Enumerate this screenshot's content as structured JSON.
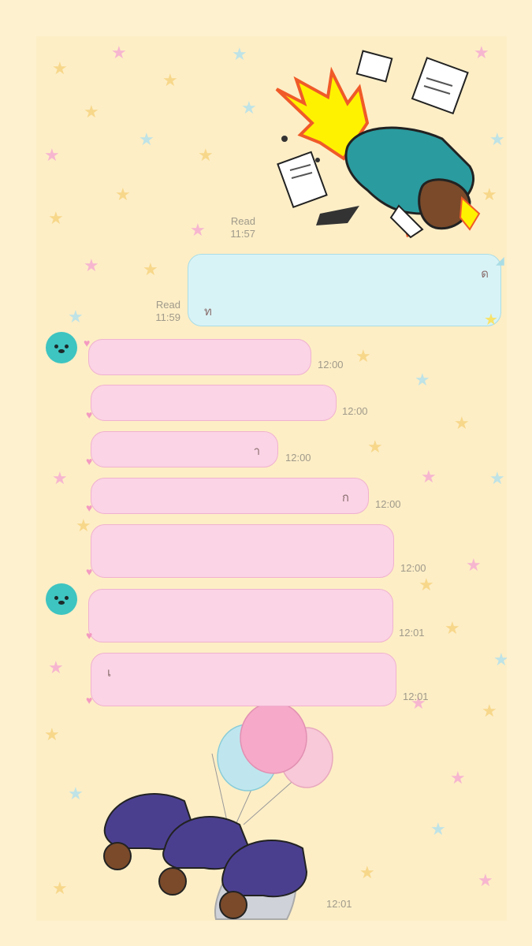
{
  "colors": {
    "background": "#fdeec6",
    "outgoing_bubble": "#d8f3f6",
    "incoming_bubble": "#fbd4e6",
    "avatar": "#3ec4c1"
  },
  "sticker_top": {
    "icon": "bowing-businessman-sticker",
    "read": "Read",
    "time": "11:57"
  },
  "outgoing_message": {
    "read": "Read",
    "time": "11:59",
    "fragments": [
      "ด",
      "ท"
    ]
  },
  "incoming_messages": [
    {
      "time": "12:00",
      "fragment": ""
    },
    {
      "time": "12:00",
      "fragment": ""
    },
    {
      "time": "12:00",
      "fragment": "า"
    },
    {
      "time": "12:00",
      "fragment": "ก"
    },
    {
      "time": "12:00",
      "fragment": ""
    },
    {
      "time": "12:01",
      "fragment": ""
    },
    {
      "time": "12:01",
      "fragment": "เ"
    }
  ],
  "sticker_bottom": {
    "icon": "three-bowing-men-balloons-sticker",
    "time": "12:01"
  }
}
